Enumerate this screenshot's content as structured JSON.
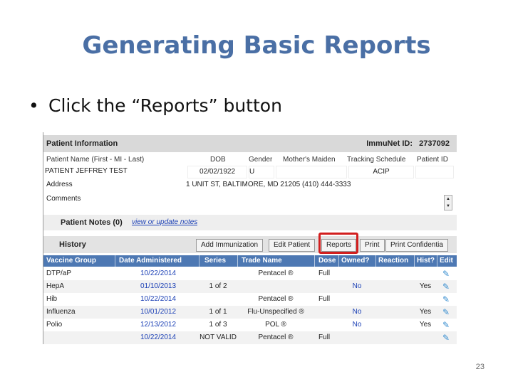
{
  "slide": {
    "title": "Generating Basic Reports",
    "bullet": "Click the “Reports” button",
    "page_number": "23"
  },
  "patient_info": {
    "header": "Patient Information",
    "immunet_label": "ImmuNet ID:",
    "immunet_id": "2737092",
    "labels": {
      "name": "Patient Name (First - MI - Last)",
      "dob": "DOB",
      "gender": "Gender",
      "maiden": "Mother's Maiden",
      "tracking": "Tracking Schedule",
      "pid": "Patient ID"
    },
    "values": {
      "name": "PATIENT JEFFREY TEST",
      "dob": "02/02/1922",
      "gender": "U",
      "maiden": "",
      "tracking": "ACIP",
      "pid": ""
    },
    "address_label": "Address",
    "address": "1 UNIT ST, BALTIMORE, MD 21205 (410) 444-3333",
    "comments_label": "Comments"
  },
  "notes": {
    "title": "Patient Notes (0)",
    "link": "view or update notes"
  },
  "history": {
    "title": "History",
    "buttons": {
      "add": "Add Immunization",
      "edit": "Edit Patient",
      "reports": "Reports",
      "print": "Print",
      "print_conf": "Print Confidentia"
    },
    "columns": [
      "Vaccine Group",
      "Date Administered",
      "Series",
      "Trade Name",
      "Dose",
      "Owned?",
      "Reaction",
      "Hist?",
      "Edit"
    ],
    "rows": [
      {
        "group": "DTP/aP",
        "date": "10/22/2014",
        "series": "",
        "trade": "Pentacel ®",
        "dose": "Full",
        "owned": "",
        "reaction": "",
        "hist": ""
      },
      {
        "group": "HepA",
        "date": "01/10/2013",
        "series": "1 of 2",
        "trade": "",
        "dose": "",
        "owned": "No",
        "reaction": "",
        "hist": "Yes"
      },
      {
        "group": "Hib",
        "date": "10/22/2014",
        "series": "",
        "trade": "Pentacel ®",
        "dose": "Full",
        "owned": "",
        "reaction": "",
        "hist": ""
      },
      {
        "group": "Influenza",
        "date": "10/01/2012",
        "series": "1 of 1",
        "trade": "Flu-Unspecified ®",
        "dose": "",
        "owned": "No",
        "reaction": "",
        "hist": "Yes"
      },
      {
        "group": "Polio",
        "date": "12/13/2012",
        "series": "1 of 3",
        "trade": "POL ®",
        "dose": "",
        "owned": "No",
        "reaction": "",
        "hist": "Yes"
      },
      {
        "group": "",
        "date": "10/22/2014",
        "series": "NOT VALID",
        "trade": "Pentacel ®",
        "dose": "Full",
        "owned": "",
        "reaction": "",
        "hist": ""
      }
    ]
  },
  "colors": {
    "title": "#4a6fa5",
    "table_header": "#4d78b3",
    "highlight": "#d21f1f",
    "link": "#1a3fb5"
  },
  "icons": {
    "edit": "syringe-icon",
    "scroll": "scroll-arrows-icon"
  }
}
